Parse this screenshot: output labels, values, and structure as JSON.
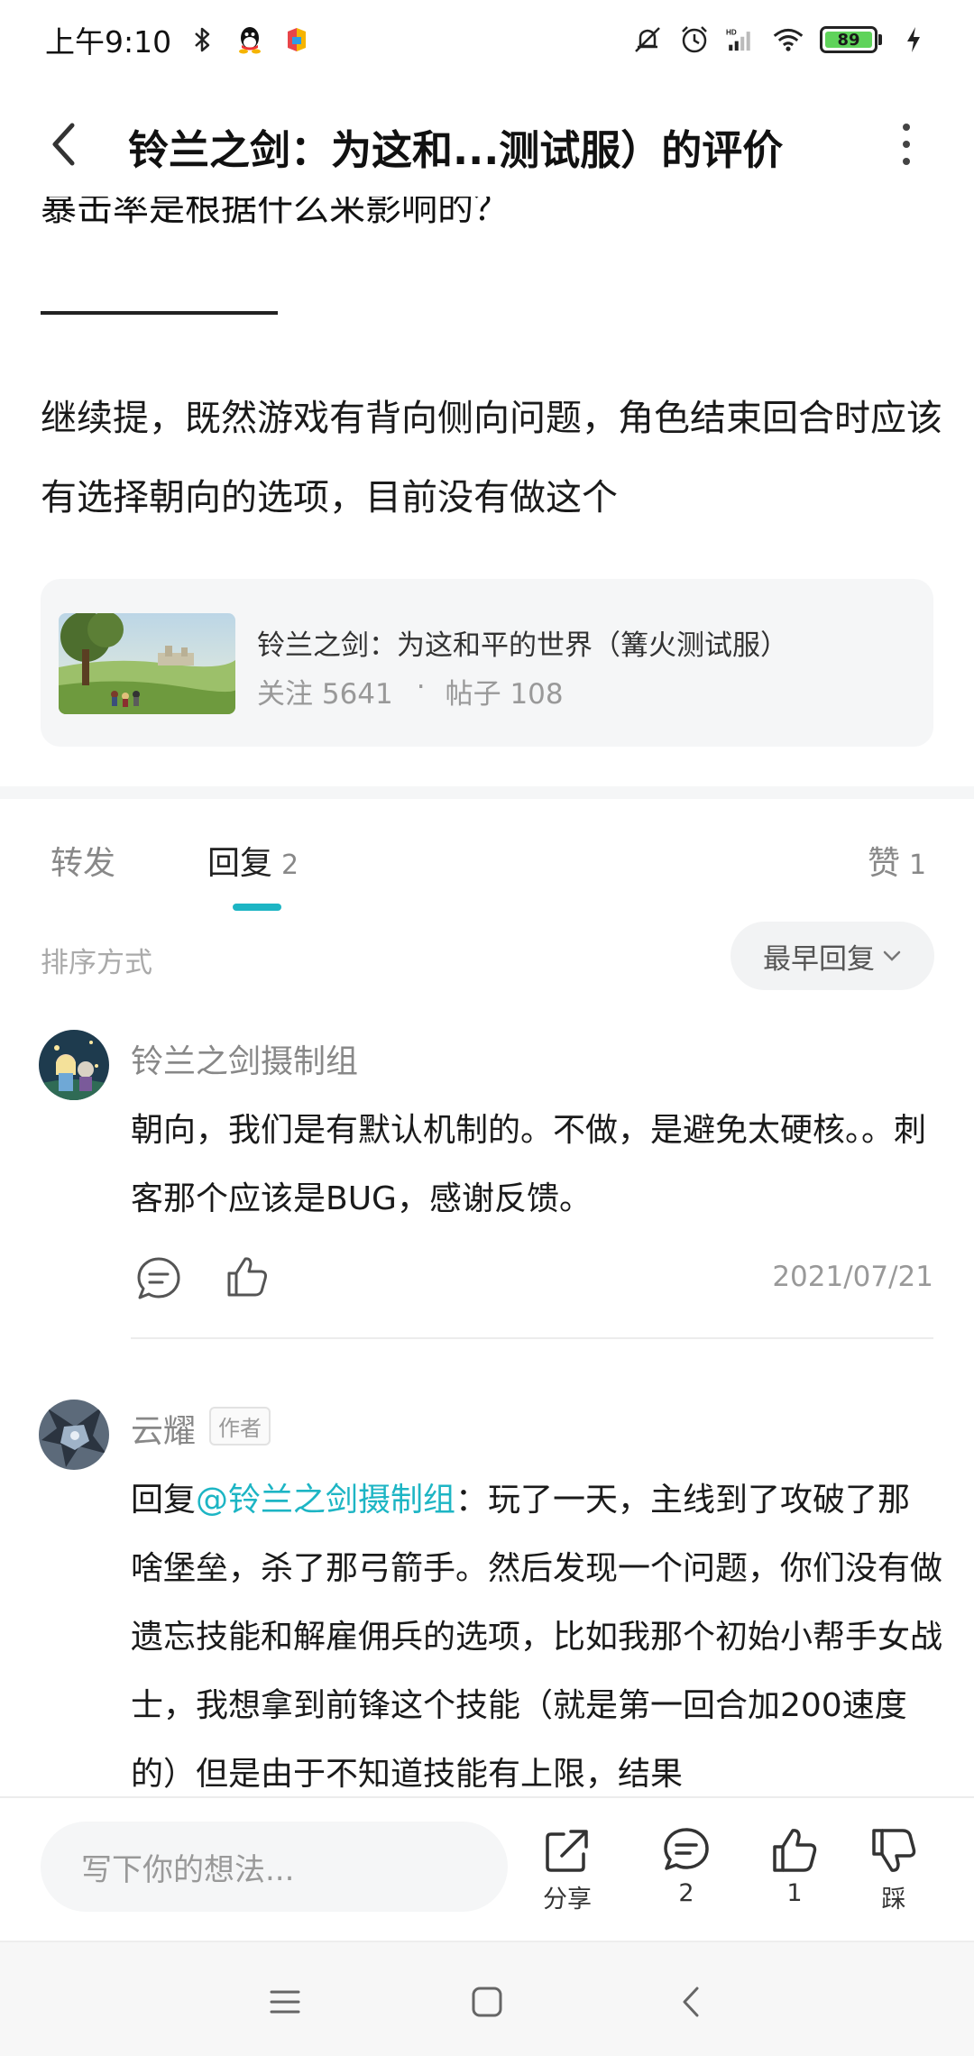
{
  "status_bar": {
    "time": "上午9:10",
    "battery": "89",
    "icons": [
      "bluetooth-icon",
      "qq-icon",
      "app-icon",
      "mute-icon",
      "alarm-icon",
      "hd-signal-icon",
      "wifi-icon",
      "battery-icon",
      "charging-icon"
    ]
  },
  "header": {
    "title": "铃兰之剑：为这和...测试服）的评价",
    "back_icon": "back-arrow-icon",
    "more_icon": "more-vertical-icon"
  },
  "post": {
    "cutoff_text": "暴击率是根据什么来影响的？",
    "paragraph": "继续提，既然游戏有背向侧向问题，角色结束回合时应该有选择朝向的选项，目前没有做这个"
  },
  "game_card": {
    "title": "铃兰之剑：为这和平的世界（篝火测试服）",
    "followers_label": "关注 5641",
    "separator": "·",
    "posts_label": "帖子 108"
  },
  "tabs": {
    "forward": "转发",
    "replies": "回复",
    "replies_count": "2",
    "likes": "赞",
    "likes_count": "1"
  },
  "sort": {
    "label": "排序方式",
    "selected": "最早回复"
  },
  "replies": [
    {
      "name": "铃兰之剑摄制组",
      "body": "朝向，我们是有默认机制的。不做，是避免太硬核。。刺客那个应该是BUG，感谢反馈。",
      "date": "2021/07/21"
    },
    {
      "name": "云耀",
      "badge": "作者",
      "reply_prefix": "回复",
      "mention": "@铃兰之剑摄制组",
      "body": "：玩了一天，主线到了攻破了那啥堡垒，杀了那弓箭手。然后发现一个问题，你们没有做遗忘技能和解雇佣兵的选项，比如我那个初始小帮手女战士，我想拿到前锋这个技能（就是第一回合加200速度的）但是由于不知道技能有上限，结果"
    }
  ],
  "bottom_bar": {
    "input_placeholder": "写下你的想法...",
    "share_label": "分享",
    "comment_count": "2",
    "like_count": "1",
    "dislike_label": "踩"
  },
  "colors": {
    "accent": "#1db5c4",
    "battery": "#5fd35a"
  }
}
